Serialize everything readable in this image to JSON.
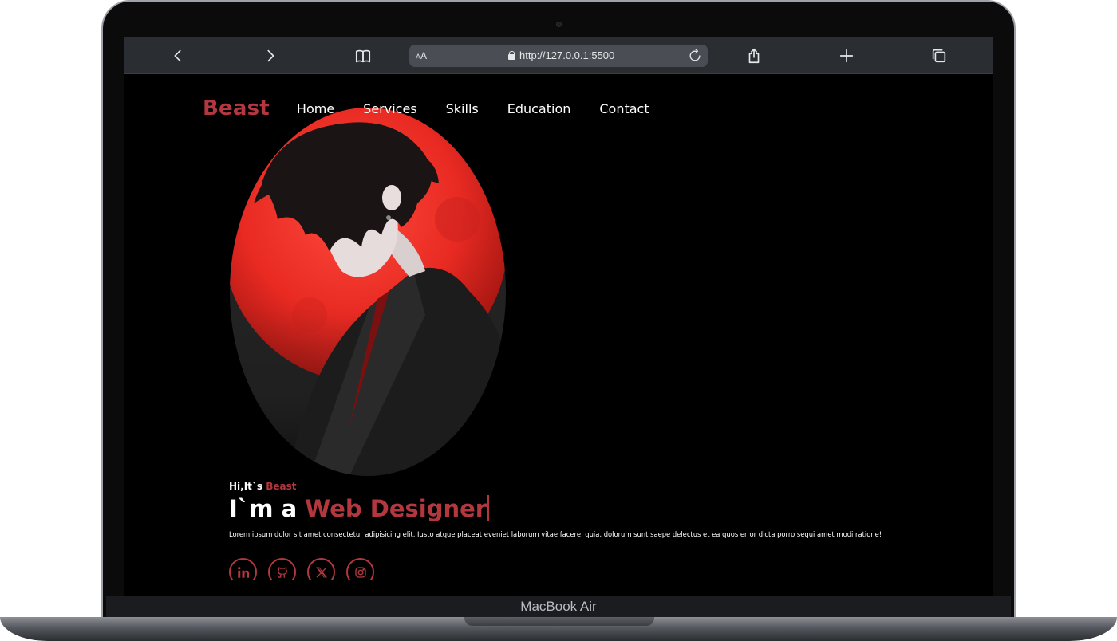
{
  "device": {
    "label": "MacBook Air"
  },
  "browser": {
    "url": "http://127.0.0.1:5500",
    "aa_label": "AA",
    "icons": [
      "back-icon",
      "forward-icon",
      "bookmarks-icon",
      "lock-icon",
      "reload-icon",
      "share-icon",
      "new-tab-icon",
      "tabs-icon"
    ]
  },
  "site": {
    "logo": "Beast",
    "nav": [
      "Home",
      "Services",
      "Skills",
      "Education",
      "Contact"
    ],
    "greeting_prefix": "Hi,It`s ",
    "greeting_name": "Beast",
    "headline_prefix": "I`m a ",
    "headline_role": "Web Designer",
    "bio": "Lorem ipsum dolor sit amet consectetur adipisicing elit. Iusto atque placeat eveniet laborum vitae facere, quia, dolorum sunt saepe delectus et ea quos error dicta porro sequi amet modi ratione!",
    "socials": [
      "linkedin-icon",
      "github-icon",
      "x-icon",
      "instagram-icon"
    ]
  },
  "colors": {
    "accent": "#b3373f",
    "page_bg": "#000000",
    "toolbar_bg": "#2a2d31",
    "address_bg": "#4a4d53"
  }
}
